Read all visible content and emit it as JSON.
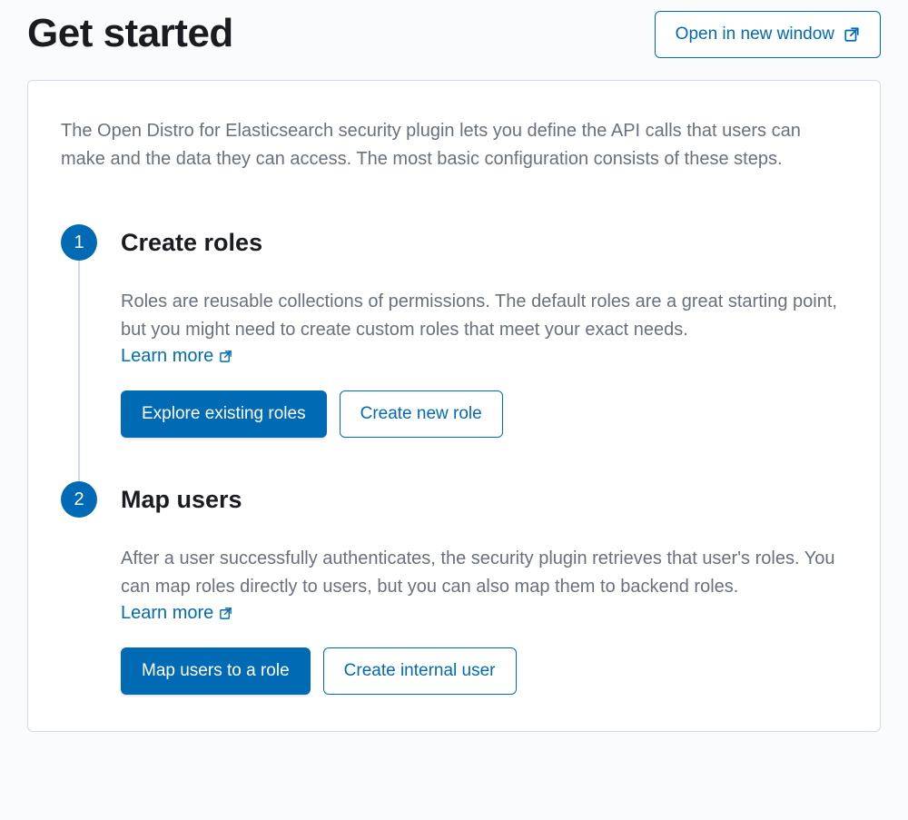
{
  "header": {
    "title": "Get started",
    "open_new_window": "Open in new window"
  },
  "intro": "The Open Distro for Elasticsearch security plugin lets you define the API calls that users can make and the data they can access. The most basic configuration consists of these steps.",
  "steps": [
    {
      "num": "1",
      "title": "Create roles",
      "desc": "Roles are reusable collections of permissions. The default roles are a great starting point, but you might need to create custom roles that meet your exact needs.",
      "learn_more": "Learn more",
      "primary_btn": "Explore existing roles",
      "secondary_btn": "Create new role"
    },
    {
      "num": "2",
      "title": "Map users",
      "desc": "After a user successfully authenticates, the security plugin retrieves that user's roles. You can map roles directly to users, but you can also map them to backend roles.",
      "learn_more": "Learn more",
      "primary_btn": "Map users to a role",
      "secondary_btn": "Create internal user"
    }
  ]
}
